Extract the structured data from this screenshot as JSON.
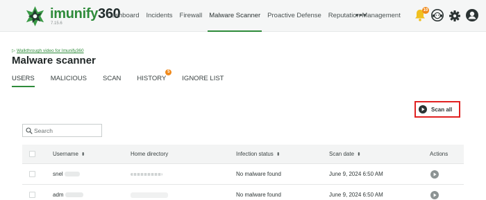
{
  "app": {
    "logo_text_main": "imunify",
    "logo_text_num": "360",
    "version": "7.15.6"
  },
  "nav": {
    "items": [
      {
        "label": "Dashboard"
      },
      {
        "label": "Incidents"
      },
      {
        "label": "Firewall"
      },
      {
        "label": "Malware Scanner"
      },
      {
        "label": "Proactive Defense"
      },
      {
        "label": "Reputation Management"
      }
    ],
    "active": "Malware Scanner",
    "more_label": "•••",
    "notification_count": "10"
  },
  "page": {
    "walkthrough_link": "Walkthrough video for Imunify360",
    "title": "Malware scanner"
  },
  "tabs": {
    "items": [
      {
        "label": "USERS"
      },
      {
        "label": "MALICIOUS"
      },
      {
        "label": "SCAN"
      },
      {
        "label": "HISTORY"
      },
      {
        "label": "IGNORE LIST"
      }
    ],
    "active": "USERS",
    "history_badge": "5"
  },
  "toolbar": {
    "scan_all_label": "Scan all"
  },
  "search": {
    "placeholder": "Search",
    "value": ""
  },
  "table": {
    "columns": {
      "username": "Username",
      "home_directory": "Home directory",
      "infection_status": "Infection status",
      "scan_date": "Scan date",
      "actions": "Actions"
    },
    "sort_glyph": "⬍",
    "rows": [
      {
        "username": "snel",
        "infection_status": "No malware found",
        "scan_date": "June 9, 2024 6:50 AM"
      },
      {
        "username": "adm",
        "infection_status": "No malware found",
        "scan_date": "June 9, 2024 6:50 AM"
      }
    ]
  },
  "colors": {
    "accent_green": "#2e8b3a",
    "badge_orange": "#f08a1c",
    "highlight_red": "#e02020"
  },
  "icons": [
    "imunify-logo-icon",
    "notifications-bell-icon",
    "support-agent-icon",
    "settings-gear-icon",
    "user-account-icon",
    "play-circle-icon",
    "search-icon",
    "red-arrow-icon"
  ]
}
